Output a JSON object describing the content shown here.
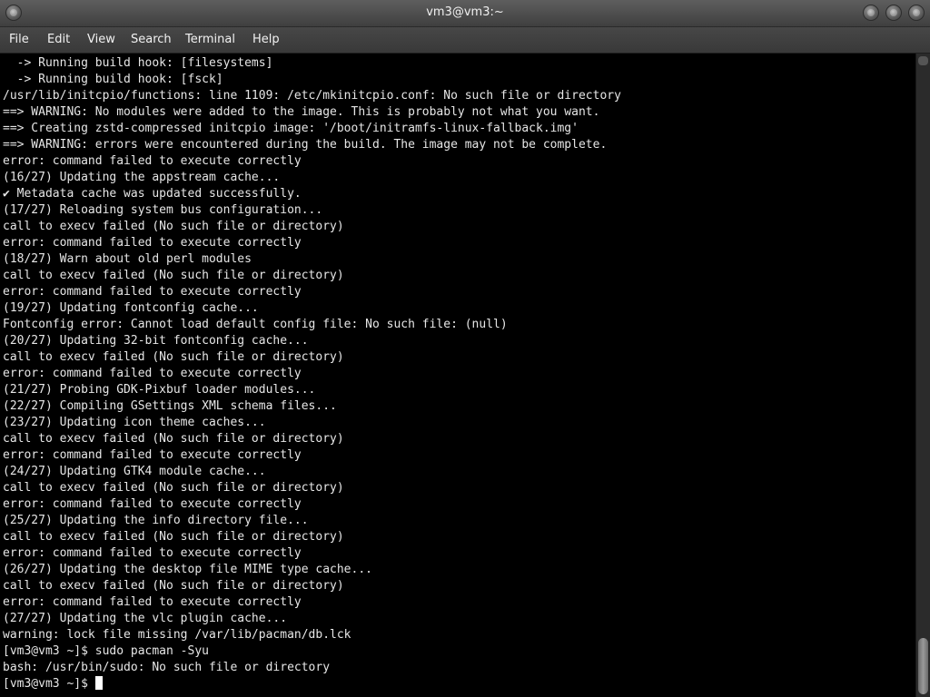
{
  "window": {
    "title": "vm3@vm3:~"
  },
  "menu": {
    "items": [
      "File",
      "Edit",
      "View",
      "Search",
      "Terminal",
      "Help"
    ]
  },
  "terminal": {
    "lines": [
      "  -> Running build hook: [filesystems]",
      "  -> Running build hook: [fsck]",
      "/usr/lib/initcpio/functions: line 1109: /etc/mkinitcpio.conf: No such file or directory",
      "==> WARNING: No modules were added to the image. This is probably not what you want.",
      "==> Creating zstd-compressed initcpio image: '/boot/initramfs-linux-fallback.img'",
      "==> WARNING: errors were encountered during the build. The image may not be complete.",
      "error: command failed to execute correctly",
      "(16/27) Updating the appstream cache...",
      "✔ Metadata cache was updated successfully.",
      "(17/27) Reloading system bus configuration...",
      "call to execv failed (No such file or directory)",
      "error: command failed to execute correctly",
      "(18/27) Warn about old perl modules",
      "call to execv failed (No such file or directory)",
      "error: command failed to execute correctly",
      "(19/27) Updating fontconfig cache...",
      "Fontconfig error: Cannot load default config file: No such file: (null)",
      "(20/27) Updating 32-bit fontconfig cache...",
      "call to execv failed (No such file or directory)",
      "error: command failed to execute correctly",
      "(21/27) Probing GDK-Pixbuf loader modules...",
      "(22/27) Compiling GSettings XML schema files...",
      "(23/27) Updating icon theme caches...",
      "call to execv failed (No such file or directory)",
      "error: command failed to execute correctly",
      "(24/27) Updating GTK4 module cache...",
      "call to execv failed (No such file or directory)",
      "error: command failed to execute correctly",
      "(25/27) Updating the info directory file...",
      "call to execv failed (No such file or directory)",
      "error: command failed to execute correctly",
      "(26/27) Updating the desktop file MIME type cache...",
      "call to execv failed (No such file or directory)",
      "error: command failed to execute correctly",
      "(27/27) Updating the vlc plugin cache...",
      "warning: lock file missing /var/lib/pacman/db.lck",
      "[vm3@vm3 ~]$ sudo pacman -Syu",
      "bash: /usr/bin/sudo: No such file or directory"
    ],
    "prompt": "[vm3@vm3 ~]$"
  },
  "scrollbar": {
    "position_fraction": 1.0
  },
  "colors": {
    "terminal_bg": "#000000",
    "terminal_fg": "#e6e6e6",
    "titlebar": "#4a4a4a",
    "menubar": "#3f3f3f"
  }
}
